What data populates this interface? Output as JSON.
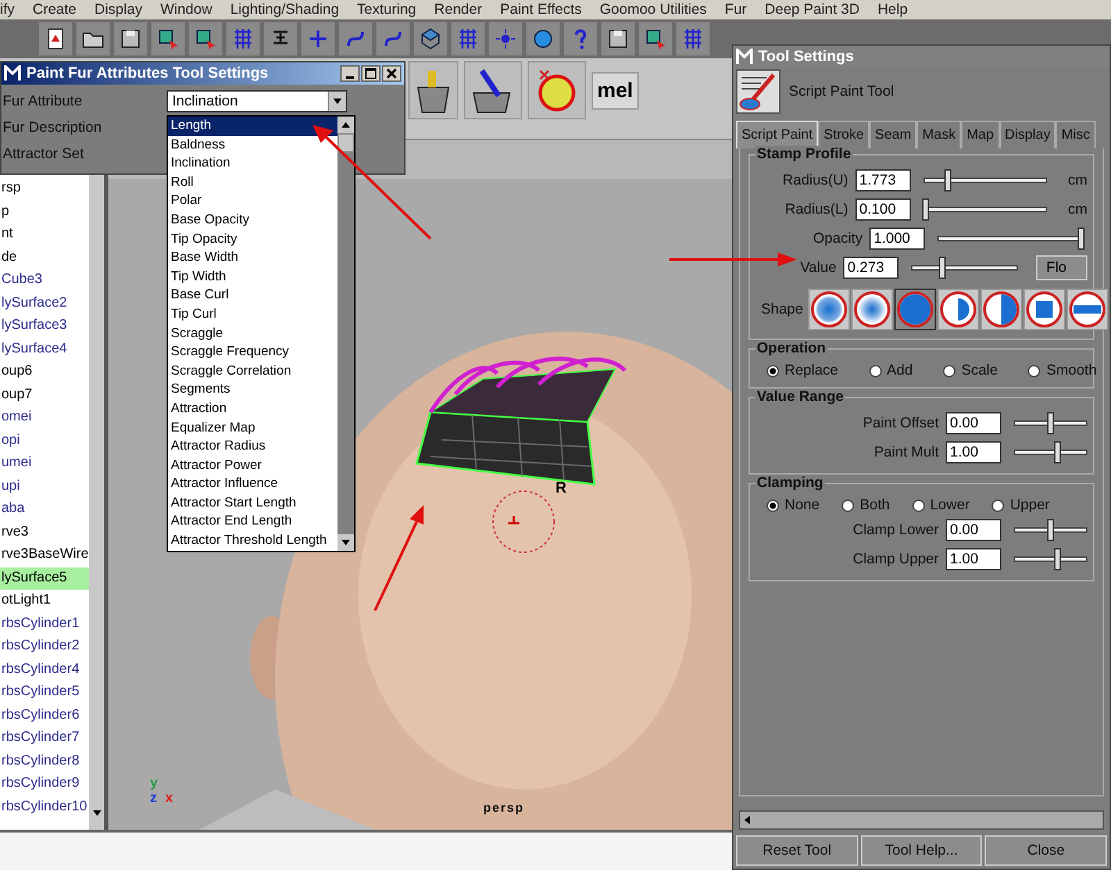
{
  "menu_bar": [
    "ify",
    "Create",
    "Display",
    "Window",
    "Lighting/Shading",
    "Texturing",
    "Render",
    "Paint Effects",
    "Goomoo Utilities",
    "Fur",
    "Deep Paint 3D",
    "Help"
  ],
  "shelf": {
    "mel_icon": "mel"
  },
  "fur_dialog": {
    "title": "Paint Fur Attributes Tool Settings",
    "rows": [
      {
        "label": "Fur Attribute",
        "value": "Inclination"
      },
      {
        "label": "Fur Description"
      },
      {
        "label": "Attractor Set"
      }
    ],
    "dropdown_items": [
      {
        "label": "Length",
        "selected": true
      },
      {
        "label": "Baldness",
        "selected": false
      },
      {
        "label": "Inclination",
        "selected": false
      },
      {
        "label": "Roll",
        "selected": false
      },
      {
        "label": "Polar",
        "selected": false
      },
      {
        "label": "Base Opacity",
        "selected": false
      },
      {
        "label": "Tip Opacity",
        "selected": false
      },
      {
        "label": "Base Width",
        "selected": false
      },
      {
        "label": "Tip Width",
        "selected": false
      },
      {
        "label": "Base Curl",
        "selected": false
      },
      {
        "label": "Tip Curl",
        "selected": false
      },
      {
        "label": "Scraggle",
        "selected": false
      },
      {
        "label": "Scraggle Frequency",
        "selected": false
      },
      {
        "label": "Scraggle Correlation",
        "selected": false
      },
      {
        "label": "Segments",
        "selected": false
      },
      {
        "label": "Attraction",
        "selected": false
      },
      {
        "label": "Equalizer Map",
        "selected": false
      },
      {
        "label": "Attractor Radius",
        "selected": false
      },
      {
        "label": "Attractor Power",
        "selected": false
      },
      {
        "label": "Attractor Influence",
        "selected": false
      },
      {
        "label": "Attractor Start Length",
        "selected": false
      },
      {
        "label": "Attractor End Length",
        "selected": false
      },
      {
        "label": "Attractor Threshold Length",
        "selected": false
      }
    ]
  },
  "outliner": {
    "items": [
      {
        "label": "rsp",
        "color": "#000000",
        "selected": false
      },
      {
        "label": "p",
        "color": "#000000",
        "selected": false
      },
      {
        "label": "nt",
        "color": "#000000",
        "selected": false
      },
      {
        "label": "de",
        "color": "#000000",
        "selected": false
      },
      {
        "label": "Cube3",
        "color": "#2b2b8c",
        "selected": false
      },
      {
        "label": "lySurface2",
        "color": "#2b2b8c",
        "selected": false
      },
      {
        "label": "lySurface3",
        "color": "#2b2b8c",
        "selected": false
      },
      {
        "label": "lySurface4",
        "color": "#2b2b8c",
        "selected": false
      },
      {
        "label": "oup6",
        "color": "#000000",
        "selected": false
      },
      {
        "label": "oup7",
        "color": "#000000",
        "selected": false
      },
      {
        "label": "omei",
        "color": "#2b2b8c",
        "selected": false
      },
      {
        "label": "opi",
        "color": "#2b2b8c",
        "selected": false
      },
      {
        "label": "umei",
        "color": "#2b2b8c",
        "selected": false
      },
      {
        "label": "upi",
        "color": "#2b2b8c",
        "selected": false
      },
      {
        "label": "aba",
        "color": "#2b2b8c",
        "selected": false
      },
      {
        "label": "rve3",
        "color": "#000000",
        "selected": false
      },
      {
        "label": "rve3BaseWire",
        "color": "#000000",
        "selected": false
      },
      {
        "label": "lySurface5",
        "color": "#000000",
        "selected": true
      },
      {
        "label": "otLight1",
        "color": "#000000",
        "selected": false
      },
      {
        "label": "rbsCylinder1",
        "color": "#2b2b8c",
        "selected": false
      },
      {
        "label": "rbsCylinder2",
        "color": "#2b2b8c",
        "selected": false
      },
      {
        "label": "rbsCylinder4",
        "color": "#2b2b8c",
        "selected": false
      },
      {
        "label": "rbsCylinder5",
        "color": "#2b2b8c",
        "selected": false
      },
      {
        "label": "rbsCylinder6",
        "color": "#2b2b8c",
        "selected": false
      },
      {
        "label": "rbsCylinder7",
        "color": "#2b2b8c",
        "selected": false
      },
      {
        "label": "rbsCylinder8",
        "color": "#2b2b8c",
        "selected": false
      },
      {
        "label": "rbsCylinder9",
        "color": "#2b2b8c",
        "selected": false
      },
      {
        "label": "rbsCylinder10",
        "color": "#2b2b8c",
        "selected": false
      }
    ]
  },
  "viewport": {
    "cursor_label": "R",
    "camera_label": "persp",
    "axes": [
      {
        "label": "y",
        "color": "#2a9a4a"
      },
      {
        "label": "z",
        "color": "#2040d0"
      },
      {
        "label": "x",
        "color": "#e02020"
      }
    ]
  },
  "tool_settings": {
    "title": "Tool Settings",
    "tool_name": "Script Paint Tool",
    "tabs": [
      {
        "label": "Script Paint",
        "selected": true
      },
      {
        "label": "Stroke",
        "selected": false
      },
      {
        "label": "Seam",
        "selected": false
      },
      {
        "label": "Mask",
        "selected": false
      },
      {
        "label": "Map",
        "selected": false
      },
      {
        "label": "Display",
        "selected": false
      },
      {
        "label": "Misc",
        "selected": false
      }
    ],
    "stamp_profile": {
      "title": "Stamp Profile",
      "sliders": [
        {
          "label": "Radius(U)",
          "value": "1.773",
          "level": 0.2,
          "unit": "cm"
        },
        {
          "label": "Radius(L)",
          "value": "0.100",
          "level": 0.03,
          "unit": "cm"
        },
        {
          "label": "Opacity",
          "value": "1.000",
          "level": 1.0
        },
        {
          "label": "Value",
          "value": "0.273",
          "level": 0.29,
          "button": "Flo"
        }
      ],
      "shape_label": "Shape",
      "shapes": [
        {
          "kind": "gaussian",
          "selected": false
        },
        {
          "kind": "soft",
          "selected": false
        },
        {
          "kind": "solid",
          "selected": true
        },
        {
          "kind": "wedge",
          "selected": false
        },
        {
          "kind": "half",
          "selected": false
        },
        {
          "kind": "square",
          "selected": false
        },
        {
          "kind": "bar",
          "selected": false
        }
      ]
    },
    "operation": {
      "title": "Operation",
      "options": [
        {
          "label": "Replace",
          "selected": true
        },
        {
          "label": "Add",
          "selected": false
        },
        {
          "label": "Scale",
          "selected": false
        },
        {
          "label": "Smooth",
          "selected": false
        }
      ]
    },
    "value_range": {
      "title": "Value Range",
      "sliders": [
        {
          "label": "Paint Offset",
          "value": "0.00",
          "level": 0.5
        },
        {
          "label": "Paint Mult",
          "value": "1.00",
          "level": 0.6
        }
      ]
    },
    "clamping": {
      "title": "Clamping",
      "options": [
        {
          "label": "None",
          "selected": true
        },
        {
          "label": "Both",
          "selected": false
        },
        {
          "label": "Lower",
          "selected": false
        },
        {
          "label": "Upper",
          "selected": false
        }
      ],
      "sliders": [
        {
          "label": "Clamp Lower",
          "value": "0.00",
          "level": 0.5
        },
        {
          "label": "Clamp Upper",
          "value": "1.00",
          "level": 0.6
        }
      ]
    },
    "buttons": [
      "Reset Tool",
      "Tool Help...",
      "Close"
    ]
  }
}
